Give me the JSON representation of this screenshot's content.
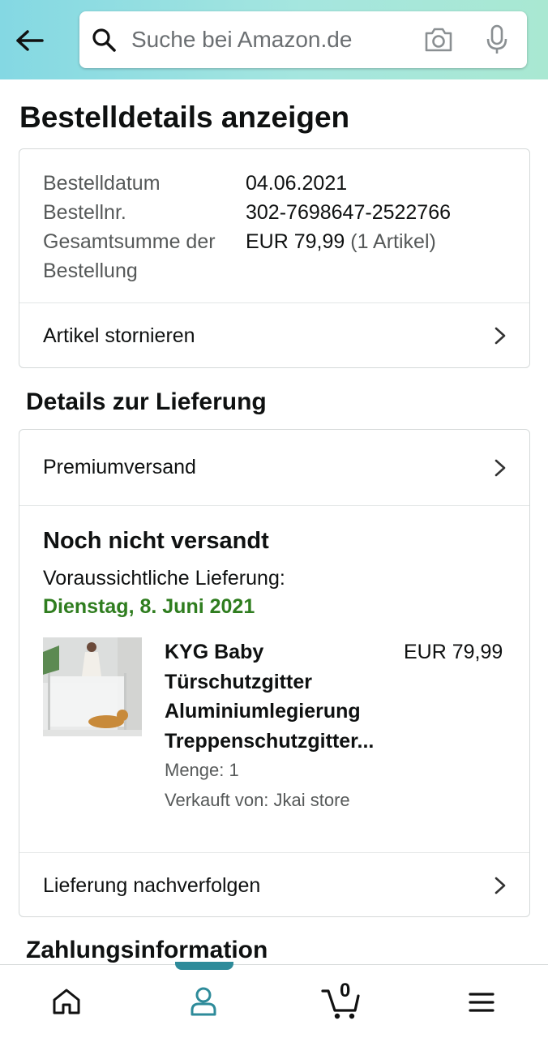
{
  "search": {
    "placeholder": "Suche bei Amazon.de"
  },
  "page_title": "Bestelldetails anzeigen",
  "order_summary": {
    "rows": [
      {
        "label": "Bestelldatum",
        "value": "04.06.2021"
      },
      {
        "label": "Bestellnr.",
        "value": "302-7698647-2522766"
      },
      {
        "label": "Gesamtsumme der Bestellung",
        "value": "EUR 79,99",
        "value_extra": "(1 Artikel)"
      }
    ],
    "cancel_label": "Artikel stornieren"
  },
  "delivery": {
    "section_title": "Details zur Lieferung",
    "shipping_method": "Premiumversand",
    "status": "Noch nicht versandt",
    "estimate_label": "Voraussichtliche Lieferung:",
    "estimate_date": "Dienstag, 8. Juni 2021",
    "item": {
      "title": "KYG Baby Türschutzgitter Aluminiumlegierung Treppenschutzgitter...",
      "price": "EUR 79,99",
      "quantity": "Menge: 1",
      "seller": "Verkauft von: Jkai store"
    },
    "track_label": "Lieferung nachverfolgen"
  },
  "payment": {
    "section_title": "Zahlungsinformation"
  },
  "bottom_nav": {
    "cart_count": "0"
  },
  "colors": {
    "accent_teal": "#2e8b9a",
    "delivery_green": "#2f7d1f"
  }
}
